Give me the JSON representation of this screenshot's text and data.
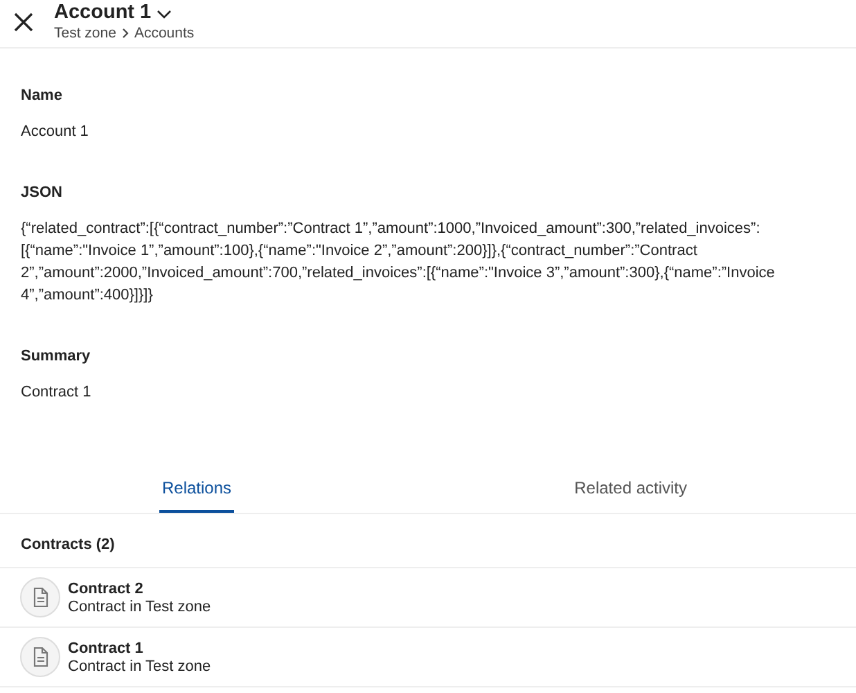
{
  "header": {
    "title": "Account 1",
    "breadcrumb": [
      "Test zone",
      "Accounts"
    ]
  },
  "fields": [
    {
      "label": "Name",
      "value": "Account 1"
    },
    {
      "label": "JSON",
      "value": "{“related_contract”:[{“contract_number”:”Contract 1”,”amount”:1000,”Invoiced_amount”:300,”related_invoices”:[{“name”:\"Invoice 1”,”amount”:100},{“name”:\"Invoice 2”,”amount”:200}]},{“contract_number”:”Contract 2”,”amount”:2000,”Invoiced_amount”:700,”related_invoices”:[{“name”:\"Invoice 3”,”amount”:300},{“name”:”Invoice 4”,”amount”:400}]}]}"
    },
    {
      "label": "Summary",
      "value": "Contract 1"
    }
  ],
  "tabs": [
    {
      "label": "Relations",
      "selected": true
    },
    {
      "label": "Related activity",
      "selected": false
    }
  ],
  "section": {
    "title": "Contracts (2)"
  },
  "items": [
    {
      "title": "Contract 2",
      "subtitle": "Contract in Test zone"
    },
    {
      "title": "Contract 1",
      "subtitle": "Contract in Test zone"
    }
  ]
}
